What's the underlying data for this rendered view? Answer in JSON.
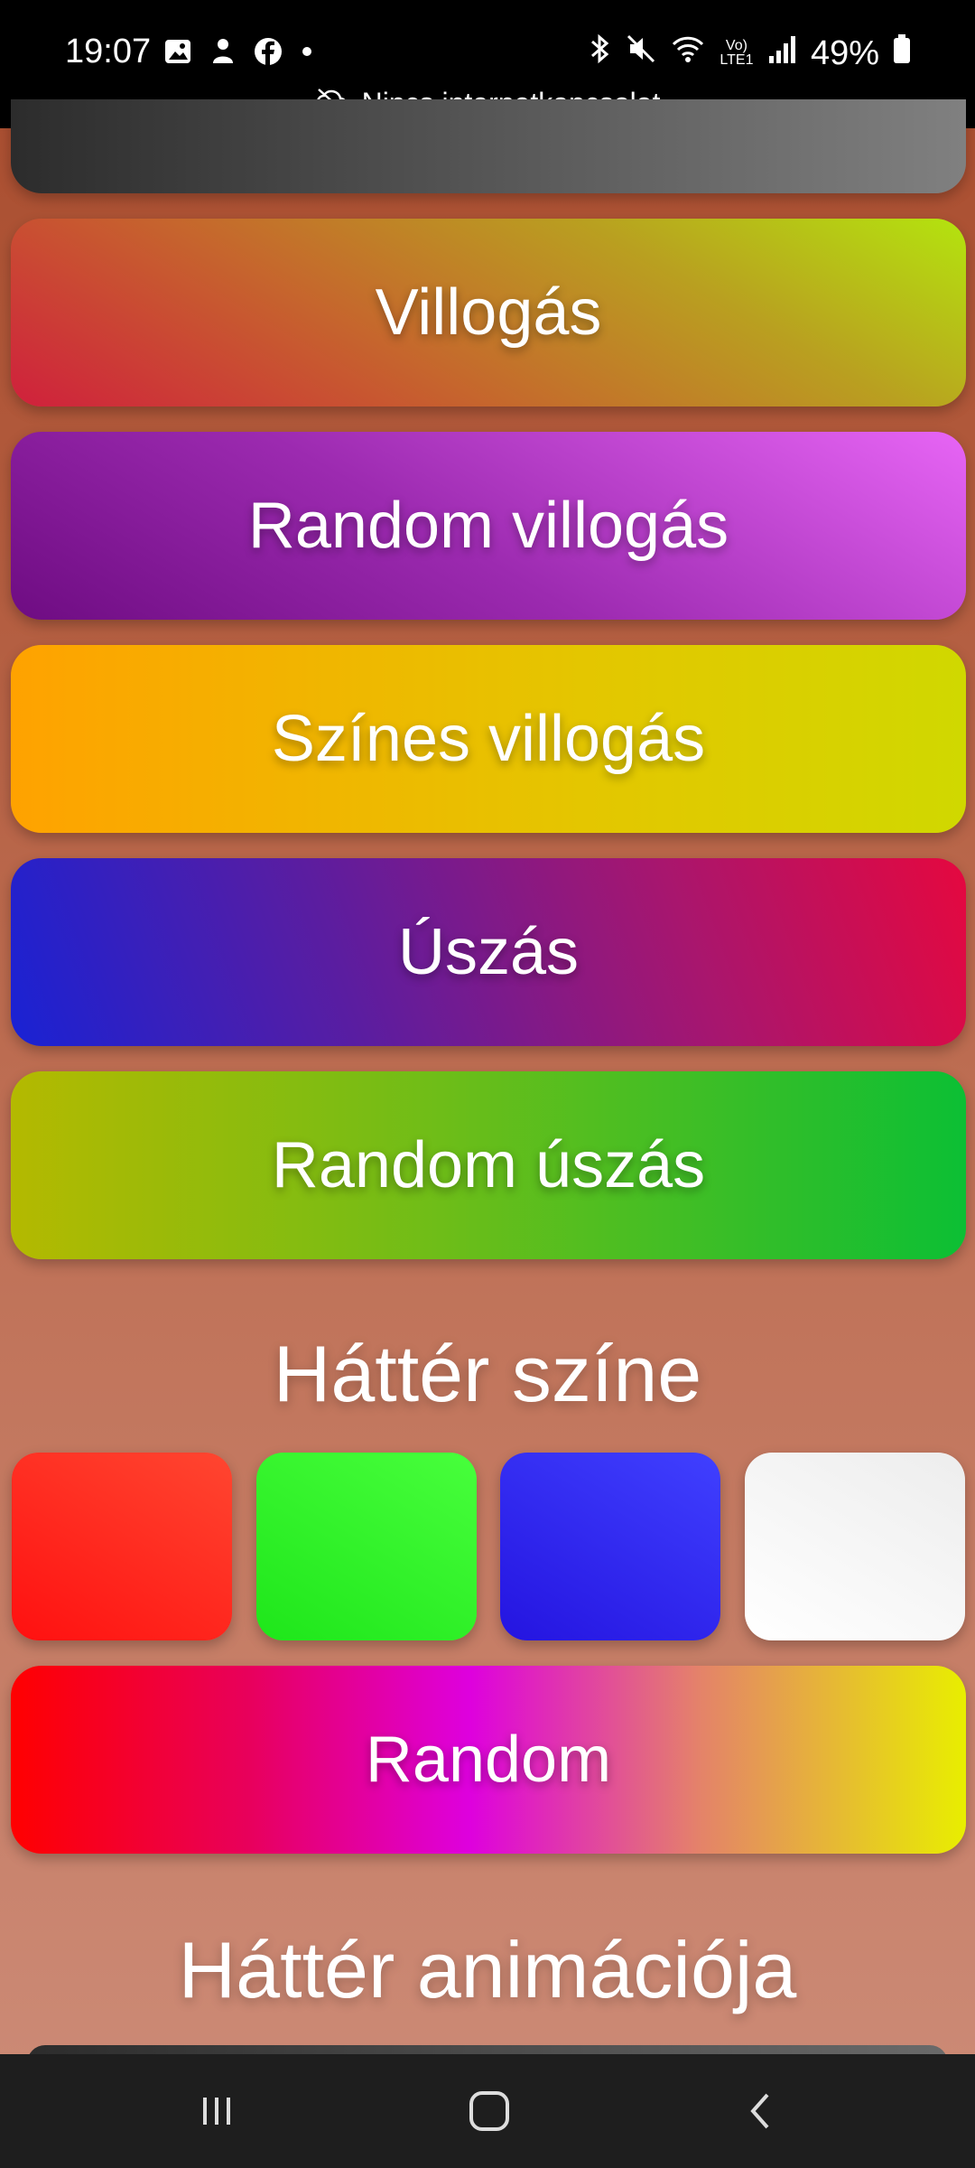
{
  "status_bar": {
    "time": "19:07",
    "battery": "49%",
    "network_notice": "Nincs internetkapcsolat",
    "lte_label": "Vo) LTE1"
  },
  "buttons": {
    "villogas": "Villogás",
    "random_villogas": "Random villogás",
    "szines_villogas": "Színes villogás",
    "uszas": "Úszás",
    "random_uszas": "Random úszás",
    "random": "Random"
  },
  "sections": {
    "background_color": "Háttér színe",
    "background_animation": "Háttér animációja"
  },
  "swatches": [
    {
      "name": "red",
      "color": "#ff2a1a"
    },
    {
      "name": "green",
      "color": "#30f028"
    },
    {
      "name": "blue",
      "color": "#3028f0"
    },
    {
      "name": "white",
      "color": "#ffffff"
    }
  ],
  "icons": {
    "status_left": [
      "gallery-icon",
      "notification-icon",
      "facebook-icon",
      "dot-icon"
    ],
    "status_right": [
      "bluetooth-icon",
      "mute-icon",
      "wifi-icon",
      "lte-icon",
      "signal-icon",
      "battery-icon"
    ],
    "nav": [
      "recents-icon",
      "home-icon",
      "back-icon"
    ]
  }
}
